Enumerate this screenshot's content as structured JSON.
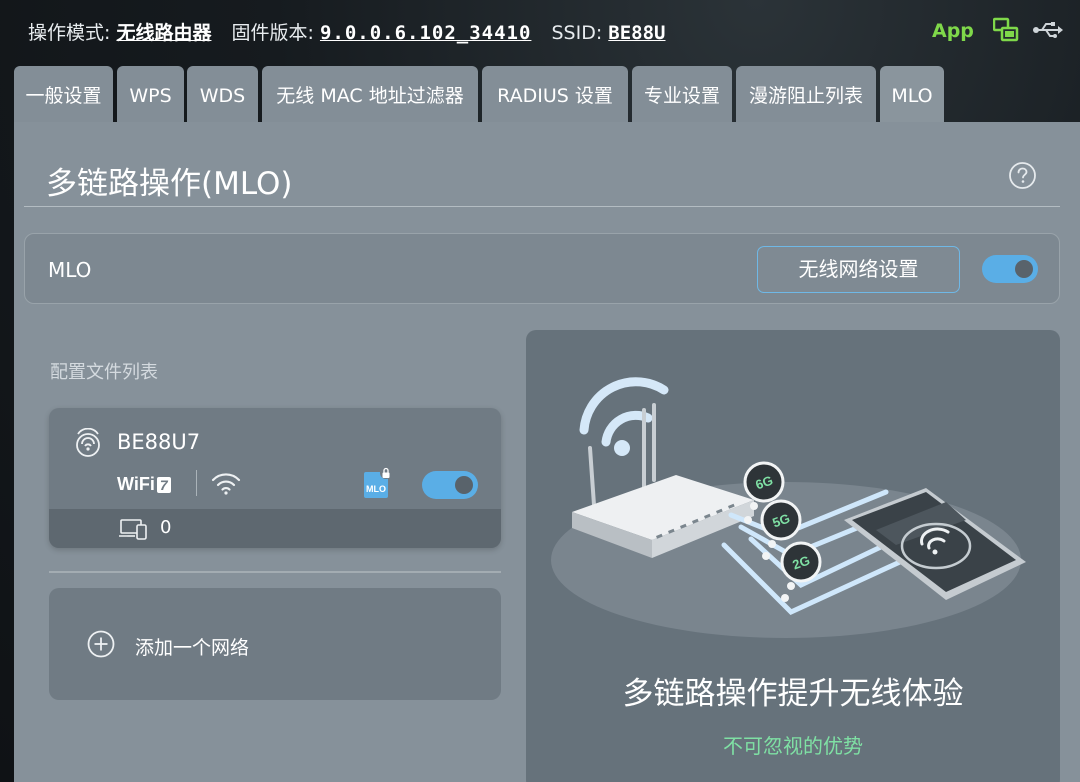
{
  "header": {
    "mode_label": "操作模式:",
    "mode_value": "无线路由器",
    "firmware_label": "固件版本:",
    "firmware_value": "9.0.0.6.102_34410",
    "ssid_label": "SSID:",
    "ssid_value": "BE88U",
    "app_label": "App",
    "app_color": "#7fd84a",
    "net_icon_color": "#7fd84a",
    "icons": [
      "network-status-icon",
      "usb-icon"
    ]
  },
  "tabs": [
    {
      "label": "一般设置",
      "active": false
    },
    {
      "label": "WPS",
      "active": false
    },
    {
      "label": "WDS",
      "active": false
    },
    {
      "label": "无线 MAC 地址过滤器",
      "active": false
    },
    {
      "label": "RADIUS 设置",
      "active": false
    },
    {
      "label": "专业设置",
      "active": false
    },
    {
      "label": "漫游阻止列表",
      "active": false
    },
    {
      "label": "MLO",
      "active": true
    }
  ],
  "panel": {
    "title": "多链路操作(MLO)",
    "help_icon": "question-circle-icon",
    "mlo_label": "MLO",
    "wireless_settings_button": "无线网络设置",
    "mlo_enabled": true,
    "profile_list_heading": "配置文件列表"
  },
  "profiles": [
    {
      "ssid": "BE88U7",
      "wifi_badge": "WiFi",
      "wifi_badge_number": "7",
      "mlo_badge": "MLO",
      "enabled": true,
      "device_count": "0"
    }
  ],
  "add_network": {
    "label": "添加一个网络"
  },
  "promo": {
    "title": "多链路操作提升无线体验",
    "subtitle": "不可忽视的优势",
    "band_labels": [
      "6G",
      "5G",
      "2G"
    ]
  },
  "colors": {
    "accent_blue": "#5aaee6",
    "promo_subtitle": "#7fe0a4",
    "panel_bg": "#86919a"
  }
}
